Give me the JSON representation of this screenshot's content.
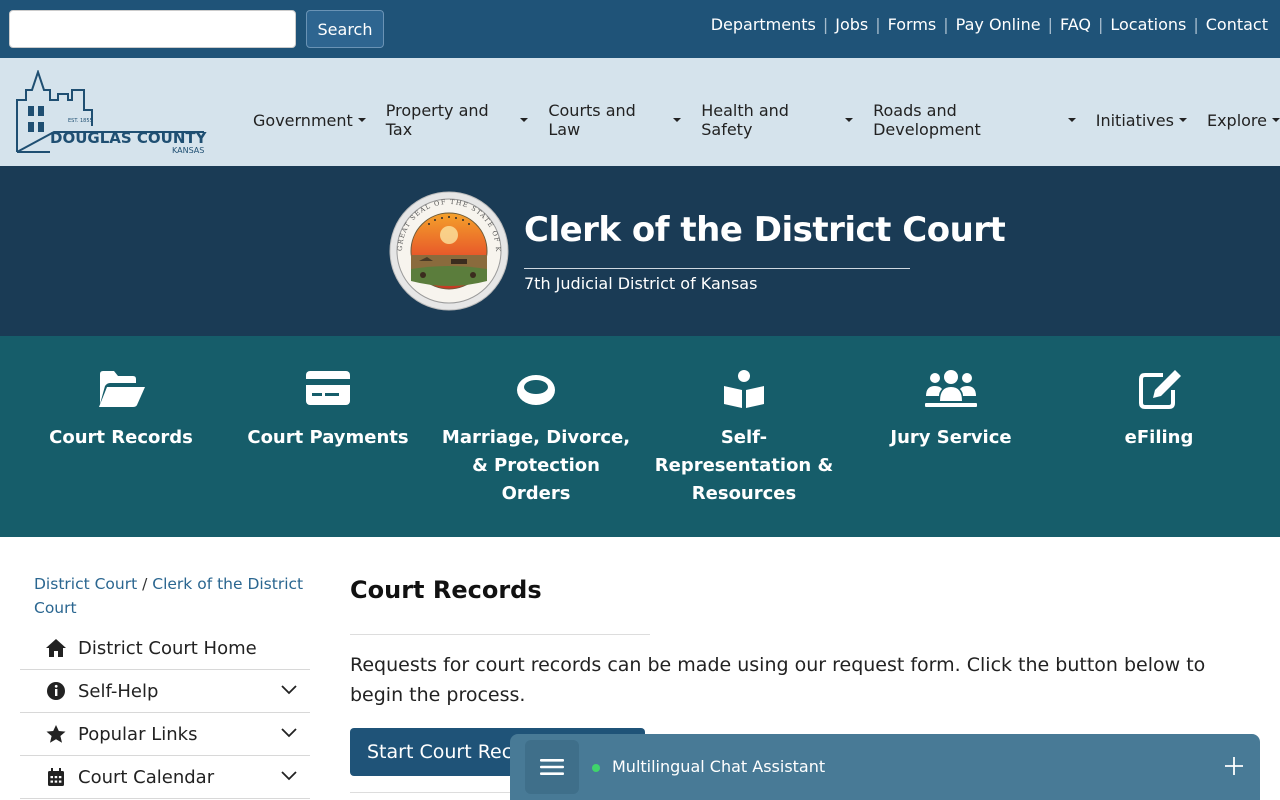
{
  "topbar": {
    "search_placeholder": "",
    "search_button": "Search",
    "links": [
      "Departments",
      "Jobs",
      "Forms",
      "Pay Online",
      "FAQ",
      "Locations",
      "Contact"
    ]
  },
  "logo": {
    "name": "DOUGLAS COUNTY",
    "state": "KANSAS",
    "est": "EST. 1855"
  },
  "mainnav": [
    "Government",
    "Property and Tax",
    "Courts and Law",
    "Health and Safety",
    "Roads and Development",
    "Initiatives",
    "Explore"
  ],
  "hero": {
    "title": "Clerk of the District Court",
    "subtitle": "7th Judicial District of Kansas",
    "seal_text": "GREAT SEAL OF THE STATE OF KANSAS"
  },
  "quick_links": [
    {
      "label": "Court Records",
      "icon": "folder-open-icon"
    },
    {
      "label": "Court Payments",
      "icon": "credit-card-icon"
    },
    {
      "label": "Marriage, Divorce, & Protection Orders",
      "icon": "ring-icon"
    },
    {
      "label": "Self-Representation & Resources",
      "icon": "book-reader-icon"
    },
    {
      "label": "Jury Service",
      "icon": "users-icon"
    },
    {
      "label": "eFiling",
      "icon": "edit-icon"
    }
  ],
  "breadcrumb": {
    "item1": "District Court",
    "sep": " / ",
    "item2": "Clerk of the District Court"
  },
  "sidenav": [
    {
      "label": "District Court Home",
      "icon": "home-icon",
      "expandable": false
    },
    {
      "label": "Self-Help",
      "icon": "info-circle-icon",
      "expandable": true
    },
    {
      "label": "Popular Links",
      "icon": "star-icon",
      "expandable": true
    },
    {
      "label": "Court Calendar",
      "icon": "calendar-icon",
      "expandable": true
    }
  ],
  "content": {
    "title": "Court Records",
    "text": "Requests for court records can be made using our request form. Click the button below to begin the process.",
    "button": "Start Court Records Request"
  },
  "chat": {
    "title": "Multilingual Chat Assistant",
    "status_color": "#3fd46b"
  },
  "colors": {
    "topbar": "#1f5378",
    "header": "#d5e3ec",
    "hero": "#1a3b55",
    "quick": "#165d6a"
  }
}
